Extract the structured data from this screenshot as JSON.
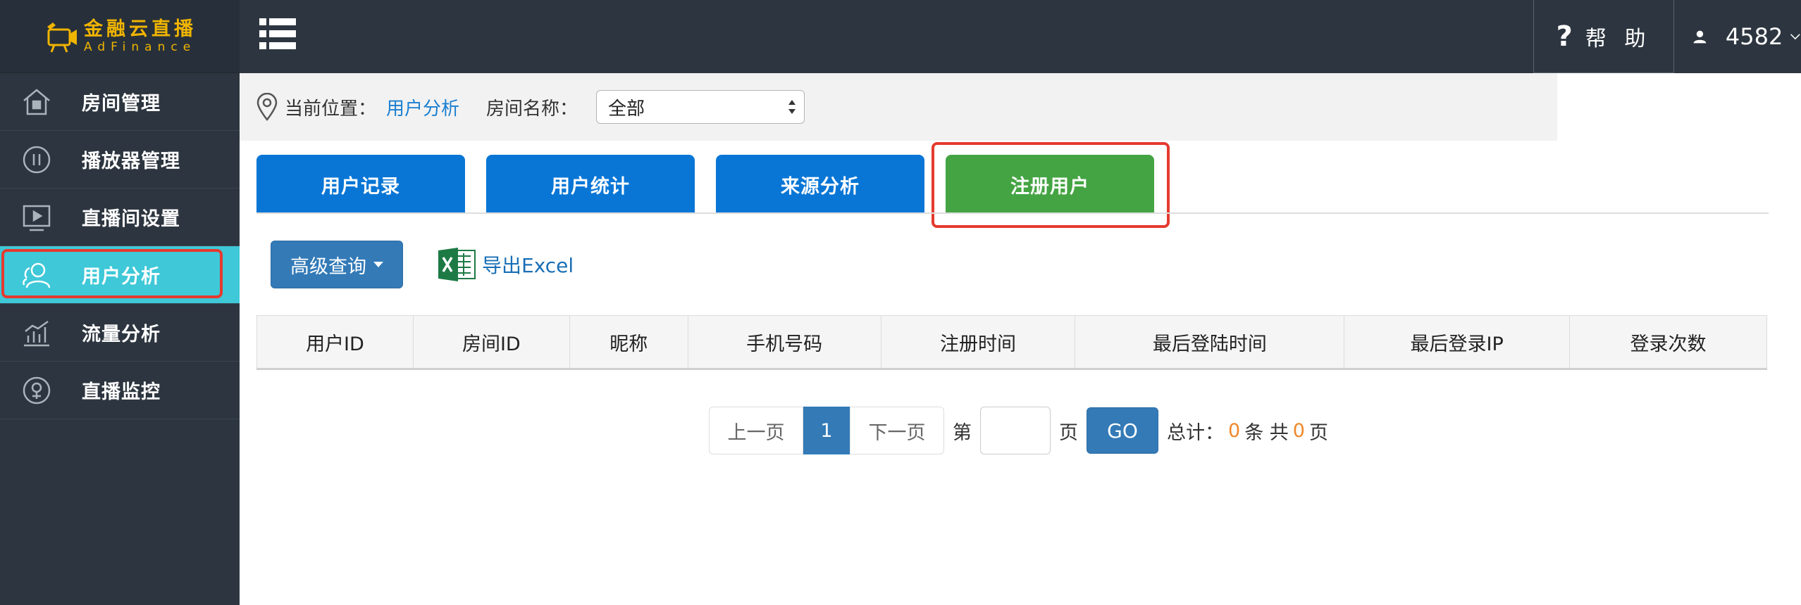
{
  "logo": {
    "cn": "金融云直播",
    "en": "AdFinance"
  },
  "sidebar": {
    "items": [
      {
        "label": "房间管理",
        "icon": "home-icon"
      },
      {
        "label": "播放器管理",
        "icon": "pause-circle-icon"
      },
      {
        "label": "直播间设置",
        "icon": "video-screen-icon"
      },
      {
        "label": "用户分析",
        "icon": "users-icon",
        "active": true
      },
      {
        "label": "流量分析",
        "icon": "bar-chart-icon"
      },
      {
        "label": "直播监控",
        "icon": "monitor-eye-icon"
      }
    ]
  },
  "topbar": {
    "help_label": "帮 助",
    "help_symbol": "?",
    "username": "4582"
  },
  "breadcrumb": {
    "prefix": "当前位置：",
    "current": "用户分析",
    "room_label": "房间名称：",
    "room_selected": "全部"
  },
  "tabs": [
    {
      "label": "用户记录",
      "color": "#0976d6"
    },
    {
      "label": "用户统计",
      "color": "#0976d6"
    },
    {
      "label": "来源分析",
      "color": "#0976d6"
    },
    {
      "label": "注册用户",
      "color": "#44a443",
      "active": true
    }
  ],
  "toolbar": {
    "advanced_query": "高级查询",
    "export_excel": "导出Excel"
  },
  "table": {
    "columns": [
      "用户ID",
      "房间ID",
      "昵称",
      "手机号码",
      "注册时间",
      "最后登陆时间",
      "最后登录IP",
      "登录次数"
    ]
  },
  "pager": {
    "prev": "上一页",
    "current_page": "1",
    "next": "下一页",
    "page_prefix": "第",
    "page_suffix": "页",
    "go": "GO",
    "total_label": "总计：",
    "total_count": "0",
    "total_unit": "条 共",
    "total_pages": "0",
    "pages_unit": "页"
  },
  "colors": {
    "sidebar_bg": "#2d3640",
    "active_nav": "#3ec8d8",
    "tab_blue": "#0976d6",
    "tab_green": "#44a443",
    "primary_button": "#337ab7",
    "highlight_border": "#e53a2f",
    "link": "#1a7fd0",
    "count_orange": "#f0882a"
  }
}
